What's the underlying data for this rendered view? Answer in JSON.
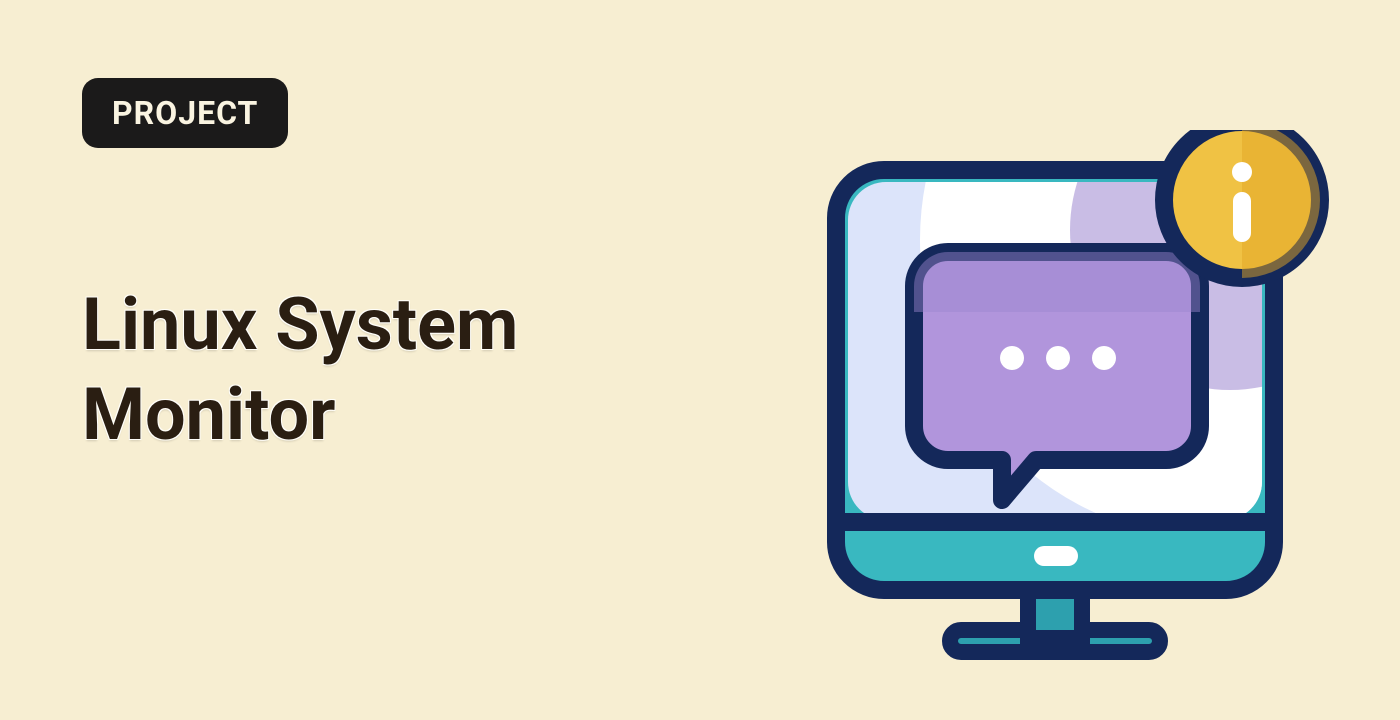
{
  "badge": {
    "label": "PROJECT"
  },
  "title": "Linux System\nMonitor",
  "colors": {
    "bg": "#f7eed2",
    "badge_bg": "#1b1a1a",
    "badge_fg": "#faf4e1",
    "title_fg": "#2a1e12",
    "stroke": "#14285a",
    "screen_light": "#dce4fa",
    "screen_white": "#ffffff",
    "stand": "#2da0ae",
    "bar": "#39b8c0",
    "bubble_fill": "#b195dc",
    "bubble_shade": "#9c86cf",
    "info_fill": "#f0c244",
    "info_shade": "#e2a524"
  },
  "icon_semantics": {
    "monitor": "monitor-icon",
    "chat": "chat-bubble-icon",
    "info": "info-badge-icon"
  }
}
